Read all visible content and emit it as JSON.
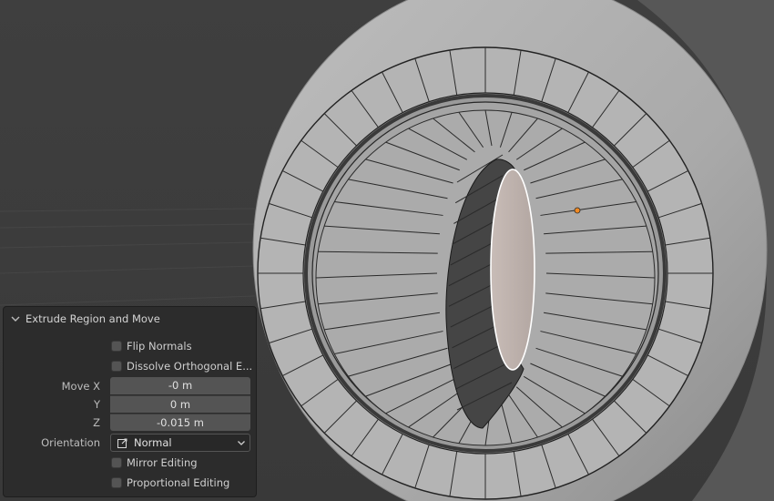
{
  "viewport": {
    "background_color": "#3d3d3d",
    "mesh_color": "#a8a8a8",
    "hole_color": "#b7aca7",
    "origin_color": "#f08a24"
  },
  "panel": {
    "title": "Extrude Region and Move",
    "collapse_icon": "chevron-down-icon",
    "flip_normals_label": "Flip Normals",
    "flip_normals_checked": false,
    "dissolve_label": "Dissolve Orthogonal E...",
    "dissolve_checked": false,
    "move_x_label": "Move X",
    "move_x_value": "-0 m",
    "move_y_label": "Y",
    "move_y_value": "0 m",
    "move_z_label": "Z",
    "move_z_value": "-0.015 m",
    "orientation_label": "Orientation",
    "orientation_value": "Normal",
    "orientation_icon": "orientation-normal-icon",
    "mirror_label": "Mirror Editing",
    "mirror_checked": false,
    "proportional_label": "Proportional Editing",
    "proportional_checked": false
  }
}
